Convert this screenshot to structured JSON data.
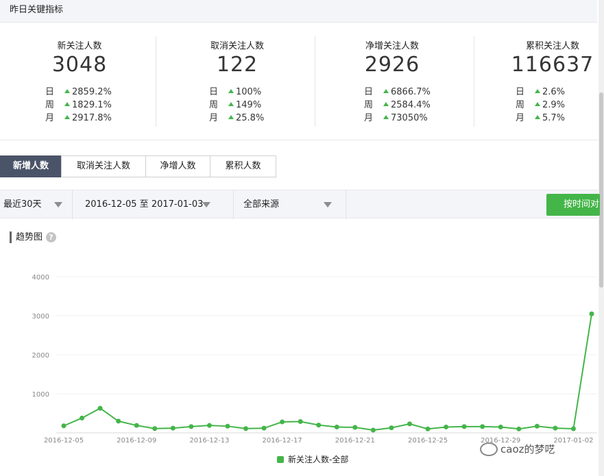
{
  "header": {
    "title": "昨日关键指标"
  },
  "metrics": [
    {
      "title": "新关注人数",
      "value": "3048",
      "rows": [
        {
          "label": "日",
          "change": "2859.2%"
        },
        {
          "label": "周",
          "change": "1829.1%"
        },
        {
          "label": "月",
          "change": "2917.8%"
        }
      ]
    },
    {
      "title": "取消关注人数",
      "value": "122",
      "rows": [
        {
          "label": "日",
          "change": "100%"
        },
        {
          "label": "周",
          "change": "149%"
        },
        {
          "label": "月",
          "change": "25.8%"
        }
      ]
    },
    {
      "title": "净增关注人数",
      "value": "2926",
      "rows": [
        {
          "label": "日",
          "change": "6866.7%"
        },
        {
          "label": "周",
          "change": "2584.4%"
        },
        {
          "label": "月",
          "change": "73050%"
        }
      ]
    },
    {
      "title": "累积关注人数",
      "value": "116637",
      "rows": [
        {
          "label": "日",
          "change": "2.6%"
        },
        {
          "label": "周",
          "change": "2.9%"
        },
        {
          "label": "月",
          "change": "5.7%"
        }
      ]
    }
  ],
  "tabs": [
    {
      "label": "新增人数",
      "active": true
    },
    {
      "label": "取消关注人数",
      "active": false
    },
    {
      "label": "净增人数",
      "active": false
    },
    {
      "label": "累积人数",
      "active": false
    }
  ],
  "filters": {
    "period": "最近30天",
    "date_range": "2016-12-05 至 2017-01-03",
    "source": "全部来源",
    "button": "按时间对比"
  },
  "trend": {
    "title": "趋势图",
    "help": "?"
  },
  "chart_data": {
    "type": "line",
    "x": [
      "2016-12-05",
      "2016-12-06",
      "2016-12-07",
      "2016-12-08",
      "2016-12-09",
      "2016-12-10",
      "2016-12-11",
      "2016-12-12",
      "2016-12-13",
      "2016-12-14",
      "2016-12-15",
      "2016-12-16",
      "2016-12-17",
      "2016-12-18",
      "2016-12-19",
      "2016-12-20",
      "2016-12-21",
      "2016-12-22",
      "2016-12-23",
      "2016-12-24",
      "2016-12-25",
      "2016-12-26",
      "2016-12-27",
      "2016-12-28",
      "2016-12-29",
      "2016-12-30",
      "2016-12-31",
      "2017-01-01",
      "2017-01-02",
      "2017-01-03"
    ],
    "x_tick_labels": [
      "2016-12-05",
      "2016-12-09",
      "2016-12-13",
      "2016-12-17",
      "2016-12-21",
      "2016-12-25",
      "2016-12-29",
      "2017-01-02"
    ],
    "series": [
      {
        "name": "新关注人数-全部",
        "color": "#44b549",
        "values": [
          180,
          380,
          630,
          300,
          190,
          110,
          120,
          160,
          190,
          170,
          110,
          120,
          280,
          290,
          200,
          150,
          140,
          70,
          130,
          230,
          100,
          150,
          160,
          160,
          150,
          100,
          170,
          120,
          105,
          3048
        ]
      }
    ],
    "yticks": [
      1000,
      2000,
      3000,
      4000
    ],
    "ylim": [
      0,
      4000
    ],
    "grid": true,
    "legend": "bottom-center"
  },
  "watermark": {
    "text": "caoz的梦呓"
  }
}
